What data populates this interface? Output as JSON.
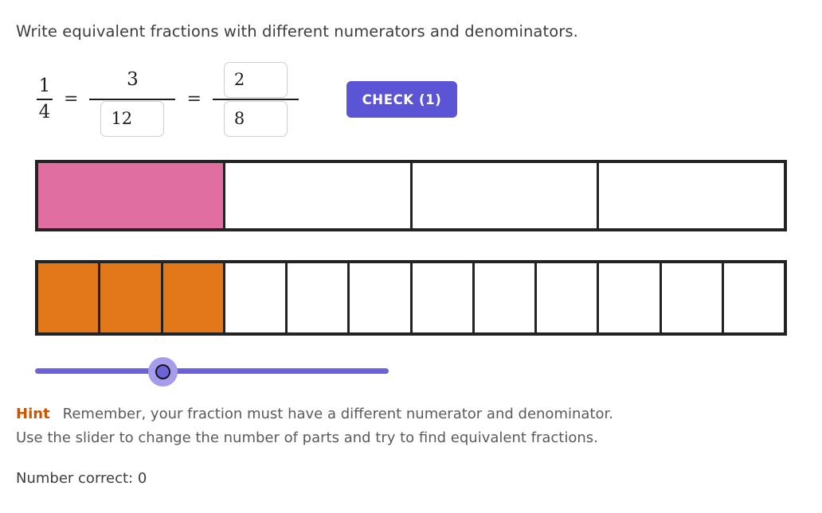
{
  "prompt": "Write equivalent fractions with different numerators and denominators.",
  "equation": {
    "fraction1": {
      "numerator": "1",
      "denominator": "4"
    },
    "equals1": "=",
    "fraction2": {
      "numerator": "3",
      "denominator_value": "12",
      "denominator_placeholder": ""
    },
    "equals2": "=",
    "fraction3": {
      "numerator_value": "2",
      "numerator_placeholder": "",
      "denominator_value": "8",
      "denominator_placeholder": ""
    }
  },
  "check_button": {
    "label": "CHECK (1)",
    "color": "#5b55d6"
  },
  "bars": {
    "top": {
      "total": 4,
      "filled": 1,
      "fill_color": "#e16ea0",
      "outline_color": "#232323"
    },
    "bottom": {
      "total": 12,
      "filled": 3,
      "fill_color": "#e3781a",
      "outline_color": "#232323"
    }
  },
  "slider": {
    "value": 12,
    "min": 2,
    "max": 24,
    "track_color": "#6c63da",
    "handle_ring_color": "#a59ceb",
    "handle_knob_color": "#6c63da"
  },
  "hint": {
    "label": "Hint",
    "label_color": "#cc5500",
    "line1": "Remember, your fraction must have a different numerator and denominator.",
    "line2": "Use the slider to change the number of parts and try to find equivalent fractions."
  },
  "status": {
    "text": "Number correct: 0"
  }
}
